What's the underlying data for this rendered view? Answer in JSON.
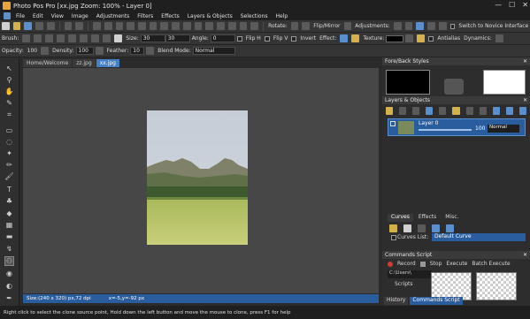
{
  "window": {
    "title": "Photo Pos Pro [xx.jpg Zoom: 100% - Layer 0]",
    "controls": [
      "—",
      "☐",
      "✕"
    ]
  },
  "menu": [
    "File",
    "Edit",
    "View",
    "Image",
    "Adjustments",
    "Filters",
    "Effects",
    "Layers & Objects",
    "Selections",
    "Help"
  ],
  "toolbar1": {
    "rotate": "Rotate:",
    "flip_mirror": "Flip/Mirror",
    "adjustments": "Adjustments:",
    "novice": "Switch to Novice Interface"
  },
  "toolbar2": {
    "brush": "Brush:",
    "size_label": "Size:",
    "size_value": "30",
    "size_value2": "30",
    "angle_label": "Angle:",
    "angle_value": "0",
    "flip_h": "Flip H",
    "flip_v": "Flip V",
    "invert": "Invert",
    "effect": "Effect:",
    "texture": "Texture:",
    "antialias": "Antialias",
    "dynamics": "Dynamics:"
  },
  "toolbar3": {
    "opacity_label": "Opacity:",
    "opacity_value": "100",
    "density_label": "Density:",
    "density_value": "100",
    "feather_label": "Feather:",
    "feather_value": "10",
    "blend_label": "Blend Mode:",
    "blend_value": "Normal"
  },
  "tabs": [
    "Home/Welcome",
    "zz.jpg",
    "xx.jpg"
  ],
  "status": {
    "size": "Size:(240 x 320) px,72 dpi",
    "pos": "x=-5,y=-92 px",
    "hint": "Right click to select the clone source point, Hold down the left button and move the mouse to clone, press F1 for help"
  },
  "panels": {
    "foreback": "Fore/Back Styles",
    "layers": "Layers & Objects",
    "layer_name": "Layer 0",
    "layer_opacity": "100",
    "layer_blend": "Normal",
    "curves_tabs": [
      "Curves",
      "Effects",
      "Misc."
    ],
    "curves_list": "Curves List:",
    "curve_item": "Default Curve",
    "commands": "Commands Script",
    "record": "Record",
    "stop": "Stop",
    "execute": "Execute",
    "batch": "Batch Execute",
    "path": "C:\\Users\\",
    "scripts": "Scripts",
    "bottom_tabs": [
      "History",
      "Commands Script"
    ]
  }
}
